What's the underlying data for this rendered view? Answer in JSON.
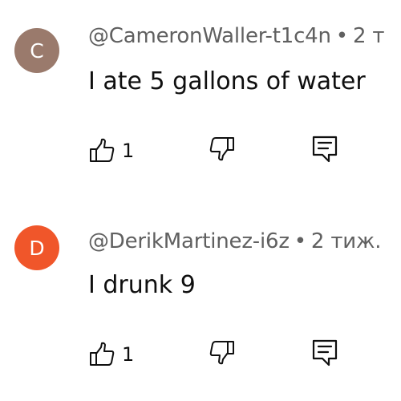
{
  "colors": {
    "avatar_c": "#9a7a6c",
    "avatar_d": "#f0562a",
    "meta_text": "#606060",
    "body_text": "#0f0f0f"
  },
  "comments": [
    {
      "avatar_letter": "C",
      "author": "@CameronWaller-t1c4n",
      "separator": "•",
      "time": "2 т",
      "text": "I ate 5 gallons of water",
      "like_count": "1",
      "icons": {
        "like": "thumbs-up-icon",
        "dislike": "thumbs-down-icon",
        "reply": "reply-comment-icon"
      }
    },
    {
      "avatar_letter": "D",
      "author": "@DerikMartinez-i6z",
      "separator": "•",
      "time": "2 тиж.",
      "text": "I drunk 9",
      "like_count": "1",
      "icons": {
        "like": "thumbs-up-icon",
        "dislike": "thumbs-down-icon",
        "reply": "reply-comment-icon"
      }
    }
  ]
}
